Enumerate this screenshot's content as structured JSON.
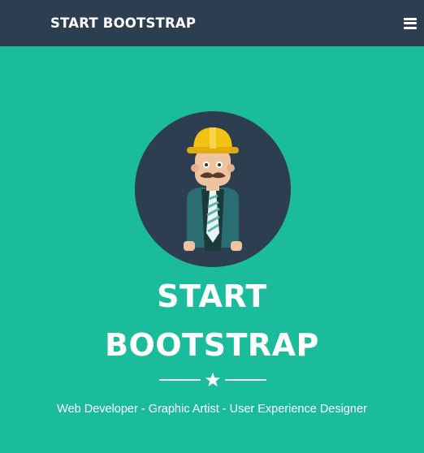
{
  "navbar": {
    "brand": "START BOOTSTRAP",
    "menu_icon": "hamburger-menu-icon"
  },
  "masthead": {
    "avatar_icon": "avatar-construction-worker-icon",
    "title_line1": "START",
    "title_line2": "BOOTSTRAP",
    "divider_icon": "star-icon",
    "subtitle": "Web Developer - Graphic Artist - User Experience Designer"
  },
  "colors": {
    "navbar_bg": "#2c3e50",
    "masthead_bg": "#1abc9c",
    "avatar_circle": "#2c3e50",
    "text": "#ffffff"
  }
}
